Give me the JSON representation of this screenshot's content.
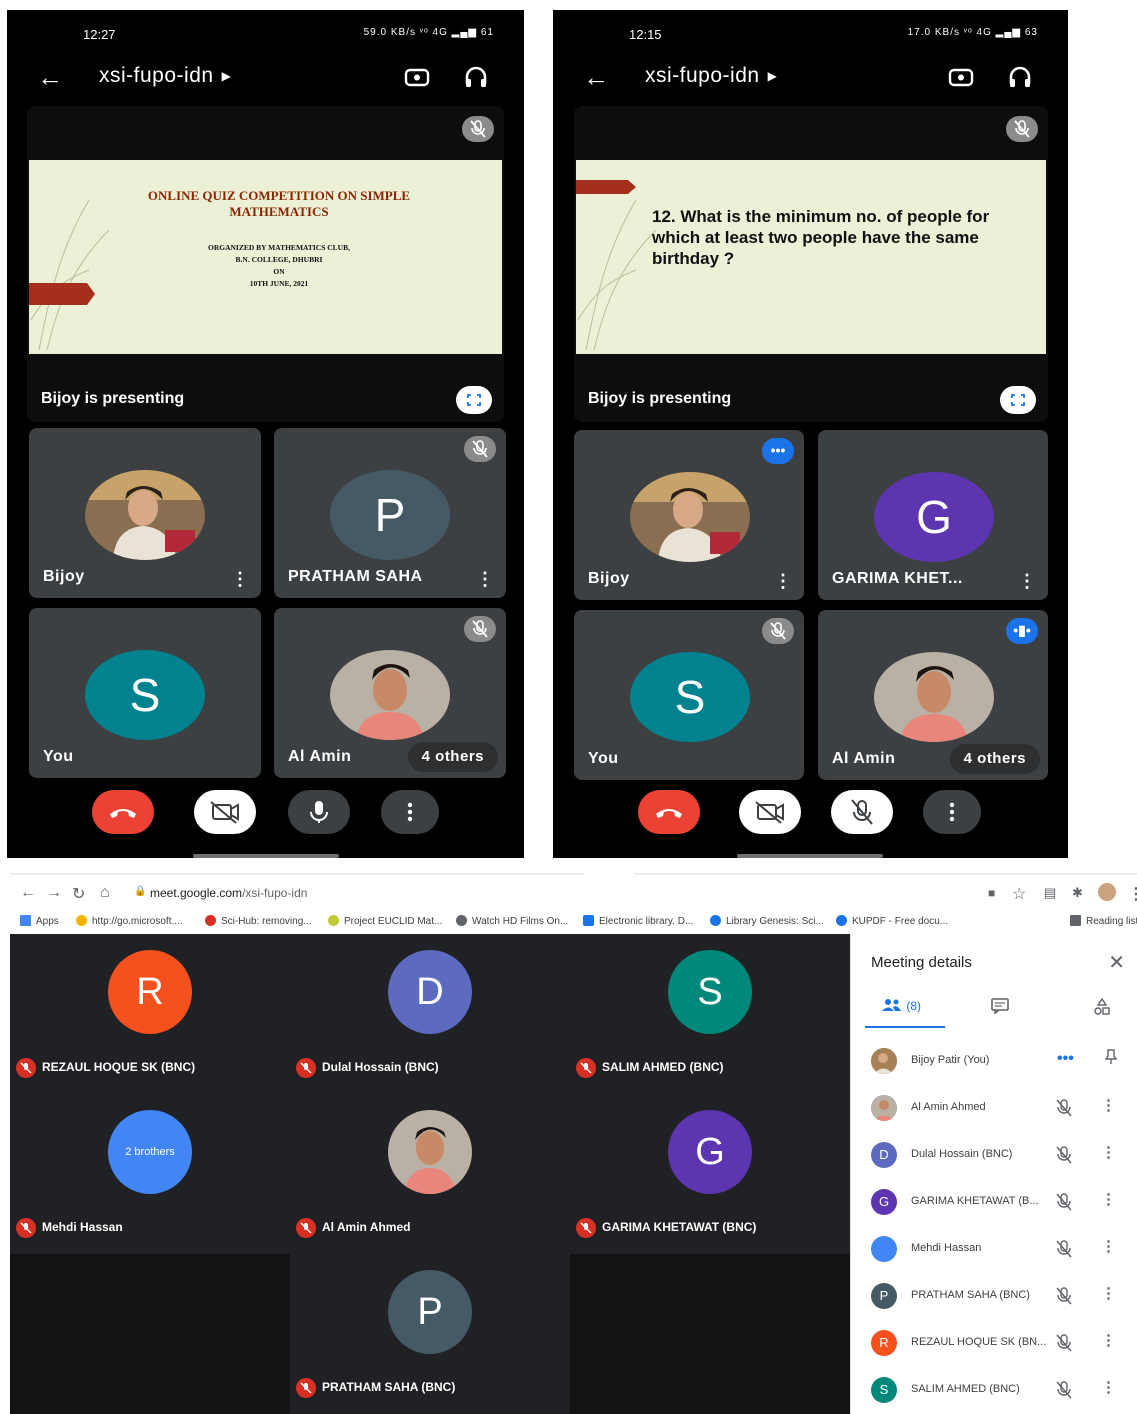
{
  "phone_left": {
    "status_time": "12:27",
    "status_right": "59.0 KB/s ᵛᵒ 4G ▂▄▆ 61",
    "meeting_code": "xsi-fupo-idn",
    "presenting_label": "Bijoy is presenting",
    "slide": {
      "title": "ONLINE QUIZ COMPETITION ON SIMPLE MATHEMATICS",
      "line1": "ORGANIZED BY MATHEMATICS CLUB,",
      "line2": "B.N. COLLEGE, DHUBRI",
      "line3": "ON",
      "line4": "10TH JUNE, 2021"
    },
    "tiles": [
      {
        "name": "Bijoy"
      },
      {
        "name": "PRATHAM SAHA",
        "initial": "P",
        "color": "#455a64"
      },
      {
        "name": "You",
        "initial": "S",
        "color": "#00838f"
      },
      {
        "name": "Al Amin",
        "others": "4 others"
      }
    ]
  },
  "phone_right": {
    "status_time": "12:15",
    "status_right": "17.0 KB/s ᵛᵒ 4G ▂▄▆ 63",
    "meeting_code": "xsi-fupo-idn",
    "presenting_label": "Bijoy is presenting",
    "slide": {
      "question": "12. What is the minimum no. of people for which at least two people have the same birthday ?"
    },
    "tiles": [
      {
        "name": "Bijoy"
      },
      {
        "name": "GARIMA KHET...",
        "initial": "G",
        "color": "#5e35b1"
      },
      {
        "name": "You",
        "initial": "S",
        "color": "#00838f"
      },
      {
        "name": "Al Amin",
        "others": "4 others"
      }
    ]
  },
  "browser": {
    "url_host": "meet.google.com",
    "url_path": "/xsi-fupo-idn",
    "bookmarks": [
      {
        "label": "Apps",
        "color": "#4285f4"
      },
      {
        "label": "http://go.microsoft....",
        "color": "#f4b400"
      },
      {
        "label": "Sci-Hub: removing...",
        "color": "#d93025"
      },
      {
        "label": "Project EUCLID Mat...",
        "color": "#c0ca33"
      },
      {
        "label": "Watch HD Films On...",
        "color": "#5f6368"
      },
      {
        "label": "Electronic library. D...",
        "color": "#1a73e8"
      },
      {
        "label": "Library Genesis: Sci...",
        "color": "#1a73e8"
      },
      {
        "label": "KUPDF - Free docu...",
        "color": "#1a73e8"
      },
      {
        "label": "Reading list",
        "color": "#5f6368"
      }
    ],
    "grid": [
      {
        "name": "REZAUL HOQUE SK (BNC)",
        "initial": "R",
        "color": "#f4511e"
      },
      {
        "name": "Dulal Hossain (BNC)",
        "initial": "D",
        "color": "#5c6bc0"
      },
      {
        "name": "SALIM AHMED (BNC)",
        "initial": "S",
        "color": "#00897b"
      },
      {
        "name": "Mehdi Hassan",
        "initial": "2 brothers",
        "color": "#4285f4"
      },
      {
        "name": "Al Amin Ahmed"
      },
      {
        "name": "GARIMA KHETAWAT (BNC)",
        "initial": "G",
        "color": "#5e35b1"
      },
      {
        "name": "PRATHAM SAHA (BNC)",
        "initial": "P",
        "color": "#455a64"
      }
    ],
    "panel": {
      "title": "Meeting details",
      "people_count": "(8)",
      "participants": [
        {
          "name": "Bijoy Patir (You)",
          "initial": "",
          "color": "#c9a27e"
        },
        {
          "name": "Al Amin Ahmed",
          "initial": "",
          "color": "#c98a6a"
        },
        {
          "name": "Dulal Hossain (BNC)",
          "initial": "D",
          "color": "#5c6bc0"
        },
        {
          "name": "GARIMA KHETAWAT (B...",
          "initial": "G",
          "color": "#5e35b1"
        },
        {
          "name": "Mehdi Hassan",
          "initial": "",
          "color": "#4285f4"
        },
        {
          "name": "PRATHAM SAHA (BNC)",
          "initial": "P",
          "color": "#455a64"
        },
        {
          "name": "REZAUL HOQUE SK (BN...",
          "initial": "R",
          "color": "#f4511e"
        },
        {
          "name": "SALIM AHMED (BNC)",
          "initial": "S",
          "color": "#00897b"
        }
      ]
    }
  }
}
